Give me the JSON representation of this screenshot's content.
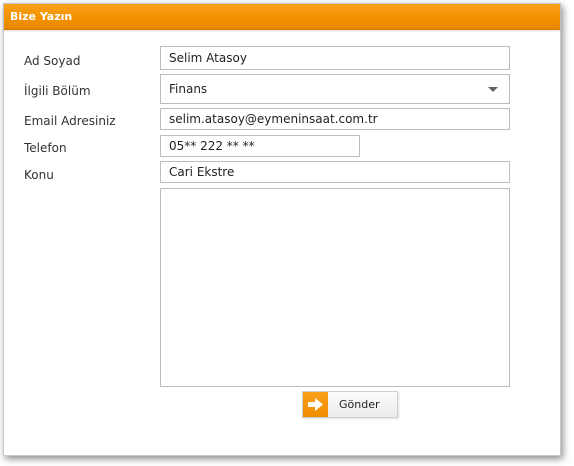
{
  "panel": {
    "title": "Bize Yazın"
  },
  "form": {
    "name": {
      "label": "Ad Soyad",
      "value": "Selim Atasoy"
    },
    "department": {
      "label": "İlgili Bölüm",
      "value": "Finans"
    },
    "email": {
      "label": "Email Adresiniz",
      "value": "selim.atasoy@eymeninsaat.com.tr"
    },
    "phone": {
      "label": "Telefon",
      "value": "05** 222 ** **"
    },
    "subject": {
      "label": "Konu",
      "value": "Cari Ekstre"
    },
    "message": {
      "value": ""
    },
    "submit": {
      "label": "Gönder",
      "icon": "arrow-right-icon"
    }
  },
  "colors": {
    "accent": "#f39200",
    "border": "#bdbdbd"
  }
}
